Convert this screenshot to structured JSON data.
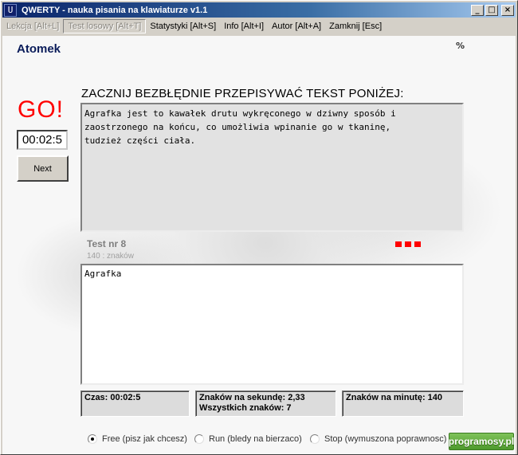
{
  "window": {
    "title": "QWERTY - nauka pisania na klawiaturze v1.1",
    "icon_glyph": "U",
    "controls": {
      "minimize": "_",
      "maximize": "□",
      "close": "×"
    }
  },
  "menu": {
    "items": [
      {
        "label": "Lekcja [Alt+L]",
        "state": "disabled"
      },
      {
        "label": "Test losowy [Alt+T]",
        "state": "pressed-disabled"
      },
      {
        "label": "Statystyki [Alt+S]",
        "state": "normal"
      },
      {
        "label": "Info [Alt+I]",
        "state": "normal"
      },
      {
        "label": "Autor [Alt+A]",
        "state": "normal"
      },
      {
        "label": "Zamknij [Esc]",
        "state": "normal"
      }
    ]
  },
  "header": {
    "logo": "Atomek",
    "percent": "%"
  },
  "status": {
    "go": "GO!",
    "timer": "00:02:5",
    "next_label": "Next"
  },
  "exercise": {
    "instruction": "ZACZNIJ BEZBŁĘDNIE PRZEPISYWAĆ TEKST PONIŻEJ:",
    "source_text": "Agrafka jest to kawałek drutu wykręconego w dziwny sposób i\nzaostrzonego na końcu, co umożliwia wpinanie go w tkaninę,\ntudzież części ciała.",
    "test_title": "Test nr 8",
    "test_chars": "140 : znaków",
    "typed_text": "Agrafka",
    "indicator_color": "#ff0000"
  },
  "stats": {
    "time": "Czas:  00:02:5",
    "chars_per_second": "Znaków na sekundę: 2,33",
    "total_chars": "Wszystkich znaków: 7",
    "chars_per_minute": "Znaków na minutę: 140"
  },
  "modes": [
    {
      "label": "Free (pisz jak chcesz)",
      "selected": true
    },
    {
      "label": "Run (bledy na bierzaco)",
      "selected": false
    },
    {
      "label": "Stop (wymuszona poprawnosc)",
      "selected": false
    }
  ],
  "watermark": "programosy.pl"
}
